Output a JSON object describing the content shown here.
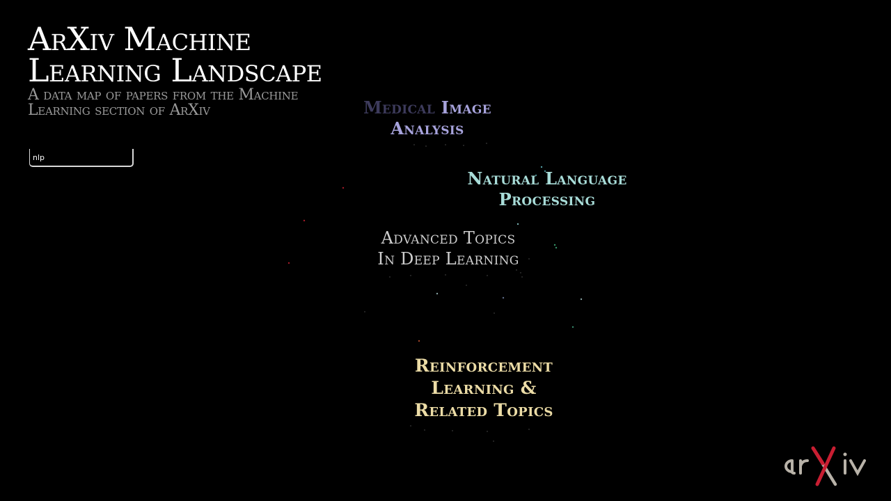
{
  "header": {
    "title_line1": "ArXiv Machine",
    "title_line2": "Learning Landscape",
    "subtitle_line1": "A data map of papers from the Machine",
    "subtitle_line2": "Learning section of ArXiv"
  },
  "search": {
    "value": "nlp",
    "placeholder": ""
  },
  "clusters": {
    "medical": {
      "line1_dim": "Medical",
      "line1_bright": "Image",
      "line2": "Analysis",
      "color": "#a7a3dc"
    },
    "nlp": {
      "line1": "Natural Language",
      "line2": "Processing",
      "color": "#a8dcd8"
    },
    "advanced": {
      "line1": "Advanced Topics",
      "line2": "In Deep Learning",
      "color": "#cfcfcf"
    },
    "rl": {
      "line1": "Reinforcement",
      "line2": "Learning &",
      "line3": "Related Topics",
      "color": "#ecdca6"
    }
  },
  "highlighted_points": [
    {
      "color": "#5fb8c0"
    },
    {
      "color": "#5fb8c0"
    },
    {
      "color": "#5fb8c0"
    },
    {
      "color": "#3fae7a"
    },
    {
      "color": "#3fae7a"
    },
    {
      "color": "#8fd0d0"
    },
    {
      "color": "#c02030"
    },
    {
      "color": "#c02030"
    },
    {
      "color": "#c02030"
    },
    {
      "color": "#c05030"
    },
    {
      "color": "#a0c0c0"
    },
    {
      "color": "#a0c0c0"
    },
    {
      "color": "#40a080"
    },
    {
      "color": "#7080a0"
    }
  ],
  "logo": {
    "text": "arXiv",
    "colors": {
      "letters": "#b8b2a8",
      "accent": "#c81e32"
    }
  }
}
